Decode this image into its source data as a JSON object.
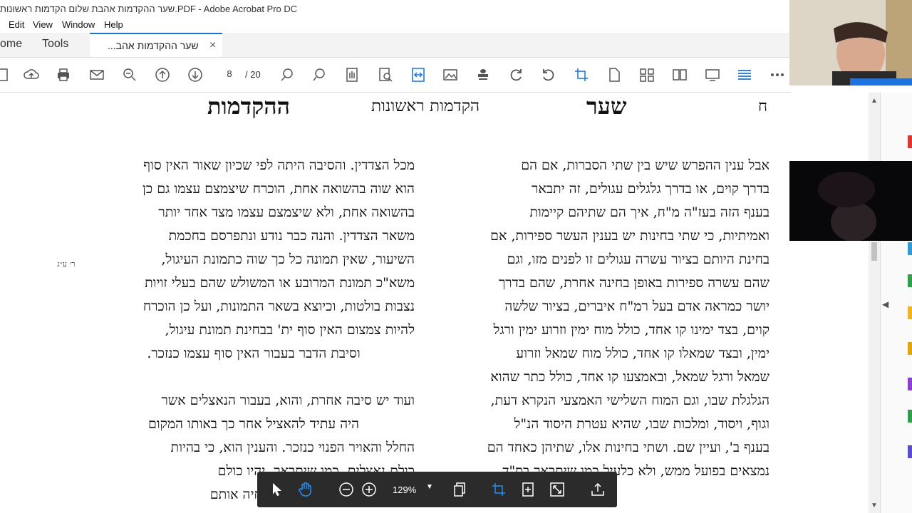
{
  "window": {
    "title": "שער ההקדמות אהבת שלום הקדמות ראשונות.PDF - Adobe Acrobat Pro DC"
  },
  "menu": [
    "Edit",
    "View",
    "Window",
    "Help"
  ],
  "nav": {
    "home": "ome",
    "tools": "Tools"
  },
  "tab": {
    "label": "שער ההקדמות אהב...",
    "close": "×"
  },
  "toolbar": {
    "page_current": "8",
    "page_total": "/ 20"
  },
  "page": {
    "number": "ח",
    "header_right": "שער",
    "header_center": "הקדמות ראשונות",
    "header_left": "ההקדמות",
    "margin_note": "ר׳ ע״ג",
    "right_column": [
      "אבל ענין ההפרש שיש בין שתי הסברות, אם הם",
      "בדרך קוים, או בדרך גלגלים עגולים, זה יתבאר",
      "בענף הזה בעז\"ה מ\"ח, איך הם שתיהם קיימות",
      "ואמיתיות, כי שתי בחינות יש בענין העשר ספירות, אם",
      "בחינת היותם בציור עשרה עגולים זו לפנים מזו, וגם",
      "שהם עשרה ספירות באופן בחינה אחרת, שהם בדרך",
      "יושר כמראה אדם בעל רמ\"ח איברים, בציור שלשה",
      "קוים, בצד ימינו קו אחד, כולל מוח ימין וזרוע ימין ורגל",
      "ימין, ובצד שמאלו קו אחד, כולל מוח שמאל וזרוע",
      "שמאל ורגל שמאל, ובאמצעו קו אחד, כולל כתר שהוא",
      "הגלגלת שבו, וגם המוח השלישי האמצעי הנקרא דעת,",
      "וגוף, ויסוד, ומלכות שבו, שהיא עטרת היסוד הנ\"ל",
      "בענף ב', ועיין שם. ושתי בחינות אלו, שתיהן כאחד הם",
      "נמצאים בפועל ממש, ולא כלעיל כמו שיתבאר בס\"ד"
    ],
    "left_column": [
      "מכל הצדדין. והסיבה היתה לפי שכיון שאור האין סוף",
      "הוא שוה בהשואה אחת, הוכרח שיצמצם עצמו גם כן",
      "בהשואה אחת, ולא שיצמצם עצמו מצד אחד יותר",
      "משאר הצדדין. והנה כבר נודע ונתפרסם בחכמת",
      "השיעור, שאין תמונה כל כך שוה כתמונת העיגול,",
      "משא\"כ תמונת המרובע או המשולש שהם בעלי זויות",
      "נצבות בולטות, וכיוצא בשאר התמונות, ועל כן הוכרח",
      "להיות צמצום האין סוף ית' בבחינת תמונת עיגול,",
      "וסיבת הדבר בעבור האין סוף עצמו כנזכר.",
      "",
      "ועוד יש סיבה אחרת, והוא, בעבור הנאצלים אשר",
      "היה עתיד להאציל אחר כך באותו המקום",
      "החלל והאויר הפנוי כנזכר. והענין הוא, כי בהיות",
      "כולם נאצלים, כמו שיתבאר, יהיו כולם",
      "סמוכים אל אין סוף המאיר ומחיה אותם"
    ]
  },
  "floating_toolbar": {
    "zoom": "129%"
  },
  "colors": {
    "accent": "#1473e6",
    "floatbar": "#2b2b2b"
  }
}
